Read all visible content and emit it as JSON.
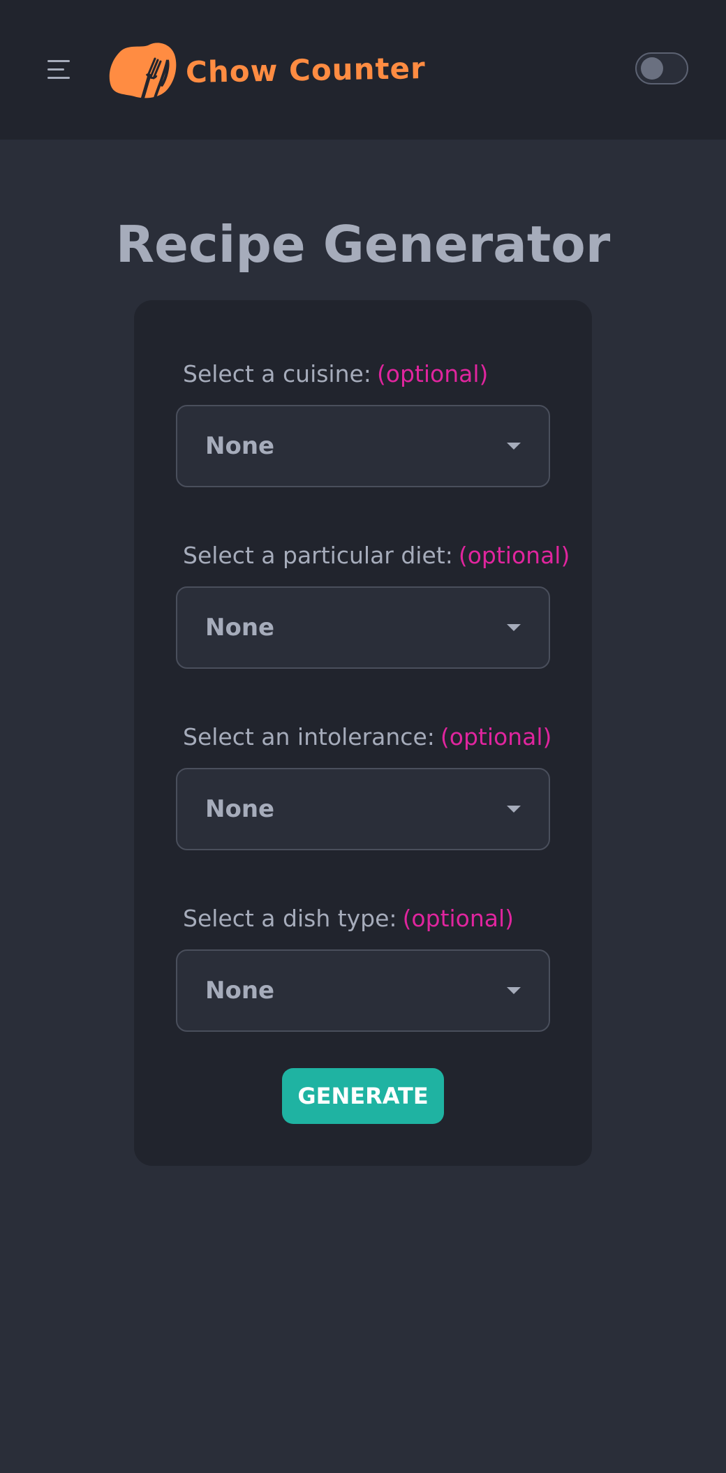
{
  "header": {
    "brand_name": "Chow Counter",
    "menu_icon": "hamburger-menu-icon",
    "logo_icon": "fork-knife-logo-icon",
    "theme_toggle_icon": "toggle-switch-icon",
    "brand_color": "#ff8c42"
  },
  "main": {
    "title": "Recipe Generator",
    "optional_color": "#e0259e",
    "accent_color": "#1fb3a2",
    "fields": [
      {
        "label": "Select a cuisine:",
        "optional": "(optional)",
        "value": "None"
      },
      {
        "label": "Select a particular diet:",
        "optional": "(optional)",
        "value": "None"
      },
      {
        "label": "Select an intolerance:",
        "optional": "(optional)",
        "value": "None"
      },
      {
        "label": "Select a dish type:",
        "optional": "(optional)",
        "value": "None"
      }
    ],
    "generate_label": "GENERATE"
  }
}
